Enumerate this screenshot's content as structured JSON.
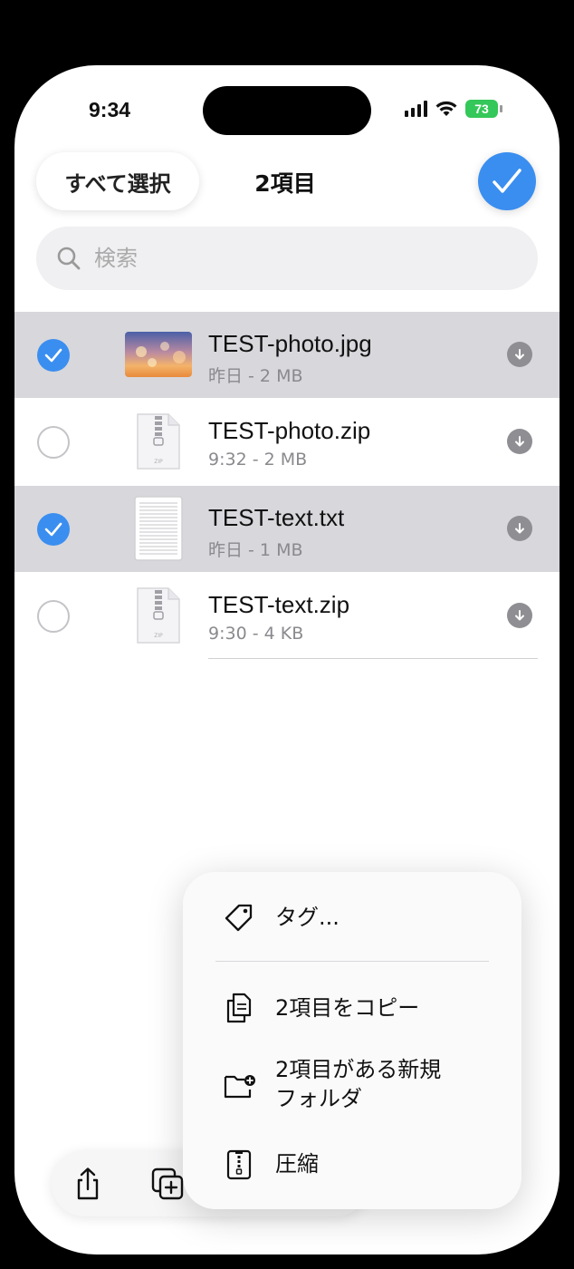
{
  "status_bar": {
    "time": "9:34",
    "battery": "73"
  },
  "header": {
    "select_all": "すべて選択",
    "title": "2項目"
  },
  "search": {
    "placeholder": "検索"
  },
  "files": [
    {
      "name": "TEST-photo.jpg",
      "meta": "昨日 - 2 MB",
      "selected": true,
      "type": "image"
    },
    {
      "name": "TEST-photo.zip",
      "meta": "9:32 - 2 MB",
      "selected": false,
      "type": "zip"
    },
    {
      "name": "TEST-text.txt",
      "meta": "昨日 - 1 MB",
      "selected": true,
      "type": "text"
    },
    {
      "name": "TEST-text.zip",
      "meta": "9:30 - 4 KB",
      "selected": false,
      "type": "zip"
    }
  ],
  "context_menu": {
    "items": [
      {
        "label": "タグ...",
        "icon": "tag-icon"
      },
      {
        "label": "2項目をコピー",
        "icon": "copy-icon"
      },
      {
        "label": "2項目がある新規\nフォルダ",
        "icon": "new-folder-icon"
      },
      {
        "label": "圧縮",
        "icon": "compress-icon"
      }
    ]
  },
  "toolbar": {
    "icons": [
      "share-icon",
      "duplicate-icon"
    ]
  },
  "colors": {
    "accent": "#3a8ef0",
    "selected_row": "#d7d7dc",
    "battery": "#34c759"
  }
}
